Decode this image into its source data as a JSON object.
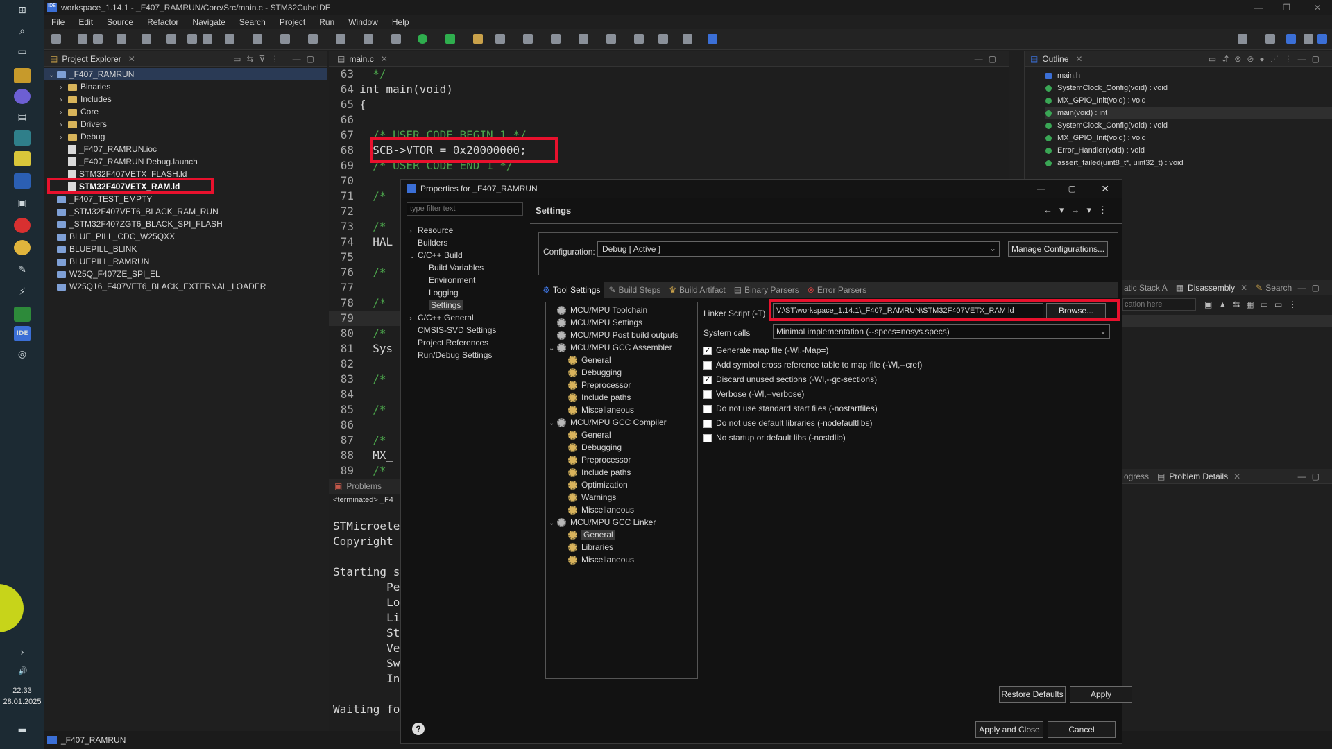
{
  "window": {
    "title": "workspace_1.14.1 - _F407_RAMRUN/Core/Src/main.c - STM32CubeIDE"
  },
  "menu": [
    "File",
    "Edit",
    "Source",
    "Refactor",
    "Navigate",
    "Search",
    "Project",
    "Run",
    "Window",
    "Help"
  ],
  "taskbar": {
    "time": "22:33",
    "date": "28.01.2025"
  },
  "project_explorer": {
    "title": "Project Explorer",
    "items": [
      {
        "label": "_F407_RAMRUN",
        "level": 0,
        "kind": "project",
        "expanded": true
      },
      {
        "label": "Binaries",
        "level": 1,
        "kind": "folder"
      },
      {
        "label": "Includes",
        "level": 1,
        "kind": "folder"
      },
      {
        "label": "Core",
        "level": 1,
        "kind": "folder"
      },
      {
        "label": "Drivers",
        "level": 1,
        "kind": "folder"
      },
      {
        "label": "Debug",
        "level": 1,
        "kind": "folder"
      },
      {
        "label": "_F407_RAMRUN.ioc",
        "level": 1,
        "kind": "file"
      },
      {
        "label": "_F407_RAMRUN Debug.launch",
        "level": 1,
        "kind": "file"
      },
      {
        "label": "STM32F407VETX_FLASH.ld",
        "level": 1,
        "kind": "file"
      },
      {
        "label": "STM32F407VETX_RAM.ld",
        "level": 1,
        "kind": "file",
        "selected": true
      },
      {
        "label": "_F407_TEST_EMPTY",
        "level": 0,
        "kind": "project"
      },
      {
        "label": "_STM32F407VET6_BLACK_RAM_RUN",
        "level": 0,
        "kind": "project"
      },
      {
        "label": "_STM32F407ZGT6_BLACK_SPI_FLASH",
        "level": 0,
        "kind": "project"
      },
      {
        "label": "BLUE_PILL_CDC_W25QXX",
        "level": 0,
        "kind": "project"
      },
      {
        "label": "BLUEPILL_BLINK",
        "level": 0,
        "kind": "project"
      },
      {
        "label": "BLUEPILL_RAMRUN",
        "level": 0,
        "kind": "project"
      },
      {
        "label": "W25Q_F407ZE_SPI_EL",
        "level": 0,
        "kind": "project"
      },
      {
        "label": "W25Q16_F407VET6_BLACK_EXTERNAL_LOADER",
        "level": 0,
        "kind": "project"
      }
    ]
  },
  "editor": {
    "tab": "main.c",
    "lines": [
      {
        "n": "63",
        "t": "  */",
        "c": "cm"
      },
      {
        "n": "64",
        "t": "int main(void)",
        "c": "code"
      },
      {
        "n": "65",
        "t": "{",
        "c": "code"
      },
      {
        "n": "66",
        "t": "",
        "c": "code"
      },
      {
        "n": "67",
        "t": "  /* USER CODE BEGIN 1 */",
        "c": "cm"
      },
      {
        "n": "68",
        "t": "  SCB->VTOR = 0x20000000;",
        "c": "code"
      },
      {
        "n": "69",
        "t": "  /* USER CODE END 1 */",
        "c": "cm"
      },
      {
        "n": "70",
        "t": "",
        "c": "code"
      },
      {
        "n": "71",
        "t": "  /*",
        "c": "cm"
      },
      {
        "n": "72",
        "t": "",
        "c": "code"
      },
      {
        "n": "73",
        "t": "  /*",
        "c": "cm"
      },
      {
        "n": "74",
        "t": "  HAL",
        "c": "code"
      },
      {
        "n": "75",
        "t": "",
        "c": "code"
      },
      {
        "n": "76",
        "t": "  /*",
        "c": "cm"
      },
      {
        "n": "77",
        "t": "",
        "c": "code"
      },
      {
        "n": "78",
        "t": "  /*",
        "c": "cm"
      },
      {
        "n": "79",
        "t": "",
        "c": "code"
      },
      {
        "n": "80",
        "t": "  /*",
        "c": "cm"
      },
      {
        "n": "81",
        "t": "  Sys",
        "c": "code"
      },
      {
        "n": "82",
        "t": "",
        "c": "code"
      },
      {
        "n": "83",
        "t": "  /*",
        "c": "cm"
      },
      {
        "n": "84",
        "t": "",
        "c": "code"
      },
      {
        "n": "85",
        "t": "  /*",
        "c": "cm"
      },
      {
        "n": "86",
        "t": "",
        "c": "code"
      },
      {
        "n": "87",
        "t": "  /*",
        "c": "cm"
      },
      {
        "n": "88",
        "t": "  MX_",
        "c": "code"
      },
      {
        "n": "89",
        "t": "  /*",
        "c": "cm"
      }
    ]
  },
  "console": {
    "tabs": [
      "Problems"
    ],
    "status": "<terminated> _F4",
    "lines": [
      "STMicroele",
      "Copyright",
      "",
      "Starting s",
      "        Pe",
      "        Lo",
      "        Li",
      "        St",
      "        Ve",
      "        Sw",
      "        In",
      "",
      "Waiting fo"
    ]
  },
  "outline": {
    "title": "Outline",
    "items": [
      {
        "label": "main.h",
        "selected": false
      },
      {
        "label": "SystemClock_Config(void) : void",
        "selected": false
      },
      {
        "label": "MX_GPIO_Init(void) : void",
        "selected": false
      },
      {
        "label": "main(void) : int",
        "selected": true
      },
      {
        "label": "SystemClock_Config(void) : void",
        "selected": false
      },
      {
        "label": "MX_GPIO_Init(void) : void",
        "selected": false
      },
      {
        "label": "Error_Handler(void) : void",
        "selected": false
      },
      {
        "label": "assert_failed(uint8_t*, uint32_t) : void",
        "selected": false
      }
    ]
  },
  "right_panels": {
    "tabs1": [
      "atic Stack A",
      "Disassembly",
      "Search"
    ],
    "disasm_placeholder": "cation here",
    "tabs2": [
      "ogress",
      "Problem Details"
    ]
  },
  "dialog": {
    "title": "Properties for _F407_RAMRUN",
    "filter_placeholder": "type filter text",
    "left_tree": [
      {
        "label": "Resource",
        "level": 0,
        "expand": "collapsed"
      },
      {
        "label": "Builders",
        "level": 0,
        "expand": "none"
      },
      {
        "label": "C/C++ Build",
        "level": 0,
        "expand": "expanded"
      },
      {
        "label": "Build Variables",
        "level": 1,
        "expand": "none"
      },
      {
        "label": "Environment",
        "level": 1,
        "expand": "none"
      },
      {
        "label": "Logging",
        "level": 1,
        "expand": "none"
      },
      {
        "label": "Settings",
        "level": 1,
        "expand": "none",
        "selected": true
      },
      {
        "label": "C/C++ General",
        "level": 0,
        "expand": "collapsed"
      },
      {
        "label": "CMSIS-SVD Settings",
        "level": 0,
        "expand": "none"
      },
      {
        "label": "Project References",
        "level": 0,
        "expand": "none"
      },
      {
        "label": "Run/Debug Settings",
        "level": 0,
        "expand": "none"
      }
    ],
    "section_title": "Settings",
    "config_label": "Configuration:",
    "config_value": "Debug  [ Active ]",
    "manage_btn": "Manage Configurations...",
    "tabs": [
      "Tool Settings",
      "Build Steps",
      "Build Artifact",
      "Binary Parsers",
      "Error Parsers"
    ],
    "tool_tree": [
      {
        "label": "MCU/MPU Toolchain",
        "level": 0
      },
      {
        "label": "MCU/MPU Settings",
        "level": 0
      },
      {
        "label": "MCU/MPU Post build outputs",
        "level": 0
      },
      {
        "label": "MCU/MPU GCC Assembler",
        "level": 0,
        "expanded": true
      },
      {
        "label": "General",
        "level": 1
      },
      {
        "label": "Debugging",
        "level": 1
      },
      {
        "label": "Preprocessor",
        "level": 1
      },
      {
        "label": "Include paths",
        "level": 1
      },
      {
        "label": "Miscellaneous",
        "level": 1
      },
      {
        "label": "MCU/MPU GCC Compiler",
        "level": 0,
        "expanded": true
      },
      {
        "label": "General",
        "level": 1
      },
      {
        "label": "Debugging",
        "level": 1
      },
      {
        "label": "Preprocessor",
        "level": 1
      },
      {
        "label": "Include paths",
        "level": 1
      },
      {
        "label": "Optimization",
        "level": 1
      },
      {
        "label": "Warnings",
        "level": 1
      },
      {
        "label": "Miscellaneous",
        "level": 1
      },
      {
        "label": "MCU/MPU GCC Linker",
        "level": 0,
        "expanded": true
      },
      {
        "label": "General",
        "level": 1,
        "selected": true
      },
      {
        "label": "Libraries",
        "level": 1
      },
      {
        "label": "Miscellaneous",
        "level": 1
      }
    ],
    "linker_label": "Linker Script (-T)",
    "linker_value": "V:\\ST\\workspace_1.14.1\\_F407_RAMRUN\\STM32F407VETX_RAM.ld",
    "browse_btn": "Browse...",
    "syscalls_label": "System calls",
    "syscalls_value": "Minimal implementation (--specs=nosys.specs)",
    "options": [
      {
        "label": "Generate map file (-Wl,-Map=)",
        "checked": true
      },
      {
        "label": "Add symbol cross reference table to map file (-Wl,--cref)",
        "checked": false
      },
      {
        "label": "Discard unused sections (-Wl,--gc-sections)",
        "checked": true
      },
      {
        "label": "Verbose (-Wl,--verbose)",
        "checked": false
      },
      {
        "label": "Do not use standard start files (-nostartfiles)",
        "checked": false
      },
      {
        "label": "Do not use default libraries (-nodefaultlibs)",
        "checked": false
      },
      {
        "label": "No startup or default libs (-nostdlib)",
        "checked": false
      }
    ],
    "restore_btn": "Restore Defaults",
    "apply_btn": "Apply",
    "apply_close_btn": "Apply and Close",
    "cancel_btn": "Cancel"
  },
  "statusbar": {
    "text": "_F407_RAMRUN"
  },
  "colors": {
    "highlight": "#e8112d",
    "accent": "#3b6fd6"
  }
}
